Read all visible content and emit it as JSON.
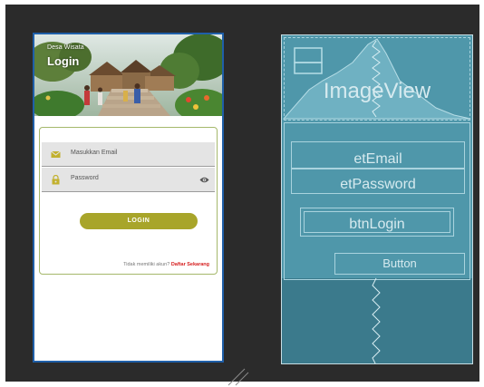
{
  "phone_preview": {
    "header": {
      "subtitle": "Desa Wisata",
      "title": "Login"
    },
    "form": {
      "email_placeholder": "Masukkan Email",
      "password_placeholder": "Password",
      "login_button": "LOGIN",
      "register_prompt": "Tidak memiliki akun?",
      "register_link": "Daftar Sekarang"
    }
  },
  "blueprint": {
    "image_view_label": "ImageView",
    "email_label": "etEmail",
    "password_label": "etPassword",
    "login_label": "btnLogin",
    "button_label": "Button"
  },
  "colors": {
    "accent_button": "#a8a52a",
    "register_link": "#d62020",
    "card_border": "#a5b86b",
    "blueprint_bg": "#3b7a8c",
    "selection_border": "#1f5fa8"
  }
}
